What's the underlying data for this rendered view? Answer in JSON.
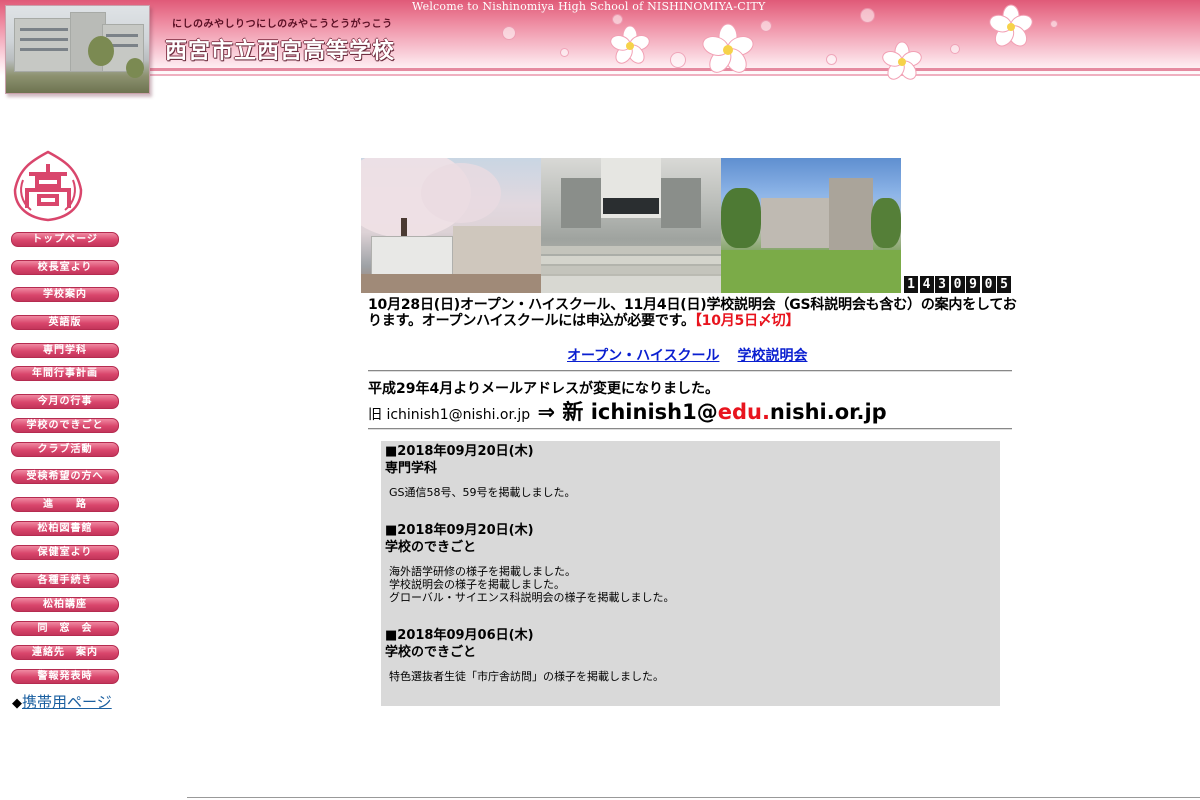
{
  "header": {
    "welcome": "Welcome to Nishinomiya High School of NISHINOMIYA-CITY",
    "kana": "にしのみやしりつにしのみやこうとうがっこう",
    "school_name": "西宮市立西宮高等学校",
    "colors": {
      "banner_top": "#e05a78",
      "banner_fade": "#fde6ec"
    }
  },
  "sidebar": {
    "emblem": "school-emblem-icon",
    "nav": [
      "トップページ",
      "校長室より",
      "学校案内",
      "英語版",
      "専門学科",
      "年間行事計画",
      "今月の行事",
      "学校のできごと",
      "クラブ活動",
      "受検希望の方へ",
      "進　　路",
      "松柏図書館",
      "保健室より",
      "各種手続き",
      "松柏講座",
      "同　窓　会",
      "連絡先　案内",
      "警報発表時"
    ],
    "mobile_bullet": "◆",
    "mobile_link": "携帯用ページ",
    "button_color": "#d9466c"
  },
  "main": {
    "counter": [
      "1",
      "4",
      "3",
      "0",
      "9",
      "0",
      "5"
    ],
    "notice_text": "10月28日(日)オープン・ハイスクール、11月4日(日)学校説明会（GS科説明会も含む）の案内をしております。オープンハイスクールには申込が必要です。",
    "notice_deadline": "【10月5日〆切】",
    "links": [
      "オープン・ハイスクール",
      "学校説明会"
    ],
    "email_notice": "平成29年4月よりメールアドレスが変更になりました。",
    "email_old_prefix": "旧 ",
    "email_old": "ichinish1@nishi.or.jp",
    "email_arrow": " ⇒ ",
    "email_new_prefix": "新 ichinish1@",
    "email_new_highlight": "edu.",
    "email_new_suffix": "nishi.or.jp",
    "accent_red": "#e8141e",
    "link_color": "#0a1fd0"
  },
  "news": [
    {
      "date": "■2018年09月20日(木)",
      "category": "専門学科",
      "lines": [
        "GS通信58号、59号を掲載しました。"
      ]
    },
    {
      "date": "■2018年09月20日(木)",
      "category": "学校のできごと",
      "lines": [
        "海外語学研修の様子を掲載しました。",
        "学校説明会の様子を掲載しました。",
        "グローバル・サイエンス科説明会の様子を掲載しました。"
      ]
    },
    {
      "date": "■2018年09月06日(木)",
      "category": "学校のできごと",
      "lines": [
        "特色選抜者生徒「市庁舎訪問」の様子を掲載しました。"
      ]
    }
  ]
}
